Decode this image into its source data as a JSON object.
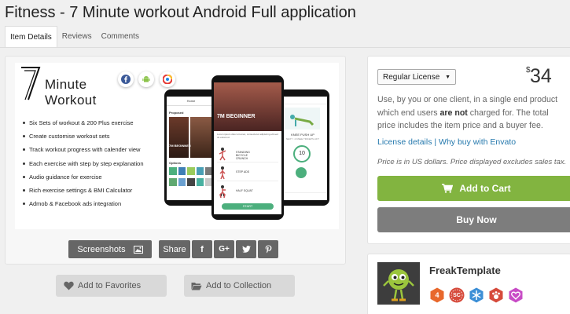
{
  "page": {
    "title": "Fitness - 7 Minute workout Android Full application"
  },
  "tabs": [
    "Item Details",
    "Reviews",
    "Comments"
  ],
  "banner": {
    "logo_line1": "Minute",
    "logo_line2": "Workout",
    "features": [
      "Six Sets of workout & 200 Plus exercise",
      "Create customise workout sets",
      "Track workout progress with calender view",
      "Each exercise with step by step explanation",
      "Audio guidance for exercise",
      "Rich exercise settings & BMI Calculator",
      "Admob & Facebook ads integration"
    ],
    "phone1": {
      "header": "Home",
      "section1": "Proposed",
      "card": "7M BEGINNER",
      "section2": "Options"
    },
    "phone2": {
      "card": "7M BEGINNER",
      "row1": "STANDING BICYCLE CRUNCH",
      "row2": "STEP ADS",
      "row3": "HALF SQUAT",
      "button": "START"
    },
    "phone3": {
      "title": "KNEE PUSH UP",
      "subtitle": "NEXT : 2 KNEE TRICEPS LIFT",
      "timer": "10"
    }
  },
  "actions": {
    "screenshots": "Screenshots",
    "share": "Share",
    "share_icons": [
      "f",
      "G+"
    ],
    "add_favorites": "Add to Favorites",
    "add_collection": "Add to Collection"
  },
  "purchase": {
    "license": "Regular License",
    "currency": "$",
    "price": "34",
    "desc_part1": "Use, by you or one client, in a single end product which end users ",
    "desc_bold": "are not",
    "desc_part2": " charged for. The total price includes the item price and a buyer fee.",
    "link1": "License details",
    "link_sep": " | ",
    "link2": "Why buy with Envato",
    "price_note": "Price is in US dollars. Price displayed excludes sales tax.",
    "add_to_cart": "Add to Cart",
    "buy_now": "Buy Now"
  },
  "author": {
    "name": "FreakTemplate",
    "badge_labels": [
      "4",
      "SC"
    ],
    "badge_colors": [
      "#e8682c",
      "#d64b3c",
      "#3d8fd6",
      "#d64b3c",
      "#c84cc6"
    ]
  },
  "colors": {
    "cart": "#82b440",
    "buy": "#7d7d7d",
    "link": "#2478ad"
  }
}
